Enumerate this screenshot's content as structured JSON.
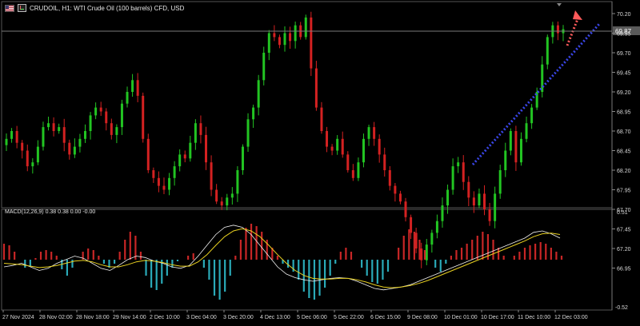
{
  "header": {
    "symbol_title": "CRUDOIL, H1:  WTI Crude Oil (100 barrels) CFD, USD"
  },
  "price_axis": {
    "labels": [
      "70.20",
      "69.95",
      "69.70",
      "69.45",
      "69.20",
      "68.95",
      "68.70",
      "68.45",
      "68.20",
      "67.95",
      "67.70",
      "67.45",
      "67.20",
      "66.95"
    ],
    "current_price": "69.87"
  },
  "macd": {
    "label": "MACD(12,26,9) 0.38 0.38 0.00 -0.00",
    "axis_top": "0.51",
    "axis_bottom": "-0.52"
  },
  "time_axis": {
    "labels": [
      "27 Nov 2024",
      "28 Nov 02:00",
      "28 Nov 18:00",
      "29 Nov 14:00",
      "2 Dec 10:00",
      "3 Dec 04:00",
      "3 Dec 20:00",
      "4 Dec 13:00",
      "5 Dec 06:00",
      "5 Dec 22:00",
      "6 Dec 15:00",
      "9 Dec 08:00",
      "10 Dec 01:00",
      "10 Dec 17:00",
      "11 Dec 10:00",
      "12 Dec 03:00"
    ]
  },
  "colors": {
    "background": "#000000",
    "bull": "#22c422",
    "bear": "#d42121",
    "grid_text": "#d8d8d8",
    "price_line": "#7a7a7a",
    "trend_line": "#3a46e8",
    "arrow": "#ff5a5a",
    "macd_pos": "#c82626",
    "macd_neg": "#2aaab8",
    "macd_line": "#f2f2f2",
    "signal_line": "#e8d020"
  },
  "chart_data": {
    "type": "candlestick",
    "title": "CRUDOIL, H1:  WTI Crude Oil (100 barrels) CFD, USD",
    "ylim": [
      66.8,
      70.35
    ],
    "close_series": [
      68.6,
      68.7,
      68.55,
      68.45,
      68.25,
      68.3,
      68.5,
      68.75,
      68.8,
      68.7,
      68.75,
      68.55,
      68.4,
      68.5,
      68.6,
      68.7,
      68.9,
      69.0,
      68.95,
      68.8,
      68.65,
      68.75,
      69.05,
      69.2,
      69.35,
      69.15,
      68.6,
      68.2,
      68.1,
      68.0,
      67.95,
      68.1,
      68.25,
      68.4,
      68.35,
      68.55,
      68.8,
      68.65,
      68.3,
      67.95,
      67.8,
      67.75,
      67.85,
      67.9,
      68.2,
      68.5,
      68.85,
      69.0,
      69.35,
      69.7,
      69.95,
      69.9,
      69.8,
      69.95,
      69.85,
      70.05,
      69.9,
      70.15,
      69.5,
      69.0,
      68.7,
      68.5,
      68.45,
      68.6,
      68.4,
      68.2,
      68.1,
      68.3,
      68.6,
      68.75,
      68.6,
      68.4,
      68.2,
      68.0,
      67.9,
      67.8,
      67.6,
      67.4,
      67.2,
      67.05,
      67.25,
      67.4,
      67.55,
      67.75,
      67.95,
      68.25,
      68.3,
      68.05,
      67.85,
      67.75,
      67.9,
      67.7,
      67.55,
      67.9,
      68.2,
      68.45,
      68.7,
      68.3,
      68.6,
      68.8,
      69.0,
      69.2,
      69.55,
      69.9,
      70.05,
      69.95,
      70.0
    ],
    "macd_histogram": [
      0.2,
      0.18,
      0.1,
      0.0,
      -0.1,
      -0.08,
      0.02,
      0.1,
      0.12,
      0.1,
      0.05,
      -0.12,
      -0.2,
      -0.1,
      0.0,
      0.1,
      0.14,
      0.12,
      0.05,
      -0.05,
      -0.1,
      -0.05,
      0.1,
      0.25,
      0.35,
      0.3,
      0.1,
      -0.2,
      -0.35,
      -0.38,
      -0.3,
      -0.2,
      -0.1,
      -0.02,
      0.0,
      0.05,
      0.08,
      0.0,
      -0.1,
      -0.25,
      -0.45,
      -0.5,
      -0.4,
      -0.2,
      0.05,
      0.25,
      0.4,
      0.45,
      0.42,
      0.35,
      0.25,
      0.15,
      0.05,
      -0.05,
      -0.1,
      -0.15,
      -0.25,
      -0.4,
      -0.48,
      -0.5,
      -0.45,
      -0.35,
      -0.2,
      -0.05,
      0.1,
      0.15,
      0.1,
      0.0,
      -0.1,
      -0.2,
      -0.28,
      -0.3,
      -0.25,
      -0.15,
      0.0,
      0.15,
      0.3,
      0.38,
      0.35,
      0.25,
      0.12,
      0.0,
      -0.1,
      -0.15,
      -0.05,
      0.05,
      0.12,
      0.15,
      0.2,
      0.25,
      0.3,
      0.35,
      0.32,
      0.25,
      0.15,
      0.05,
      0.0,
      0.05,
      0.1,
      0.15,
      0.18,
      0.2,
      0.22,
      0.2,
      0.15,
      0.1,
      0.05
    ],
    "macd_line": [
      -0.1,
      -0.08,
      -0.05,
      -0.1,
      -0.15,
      -0.12,
      -0.05,
      0.0,
      0.05,
      0.02,
      -0.05,
      -0.12,
      -0.15,
      -0.08,
      0.0,
      0.05,
      0.03,
      -0.02,
      -0.05,
      -0.1,
      -0.12,
      -0.08,
      0.05,
      0.2,
      0.35,
      0.45,
      0.48,
      0.45,
      0.35,
      0.2,
      0.05,
      -0.1,
      -0.2,
      -0.25,
      -0.28,
      -0.3,
      -0.28,
      -0.26,
      -0.25,
      -0.26,
      -0.3,
      -0.35,
      -0.4,
      -0.42,
      -0.4,
      -0.38,
      -0.35,
      -0.3,
      -0.25,
      -0.2,
      -0.15,
      -0.1,
      -0.05,
      0.0,
      0.05,
      0.1,
      0.15,
      0.2,
      0.25,
      0.3,
      0.38,
      0.4,
      0.36,
      0.3
    ],
    "signal_line": [
      -0.05,
      -0.06,
      -0.07,
      -0.09,
      -0.11,
      -0.1,
      -0.08,
      -0.05,
      -0.02,
      -0.01,
      -0.03,
      -0.07,
      -0.1,
      -0.1,
      -0.07,
      -0.03,
      -0.01,
      -0.02,
      -0.04,
      -0.07,
      -0.09,
      -0.09,
      -0.03,
      0.07,
      0.2,
      0.32,
      0.4,
      0.43,
      0.4,
      0.32,
      0.2,
      0.07,
      -0.05,
      -0.15,
      -0.22,
      -0.26,
      -0.27,
      -0.27,
      -0.26,
      -0.26,
      -0.28,
      -0.31,
      -0.35,
      -0.38,
      -0.39,
      -0.38,
      -0.36,
      -0.33,
      -0.29,
      -0.24,
      -0.19,
      -0.14,
      -0.09,
      -0.04,
      0.01,
      0.06,
      0.11,
      0.16,
      0.21,
      0.26,
      0.32,
      0.36,
      0.37,
      0.35
    ]
  }
}
